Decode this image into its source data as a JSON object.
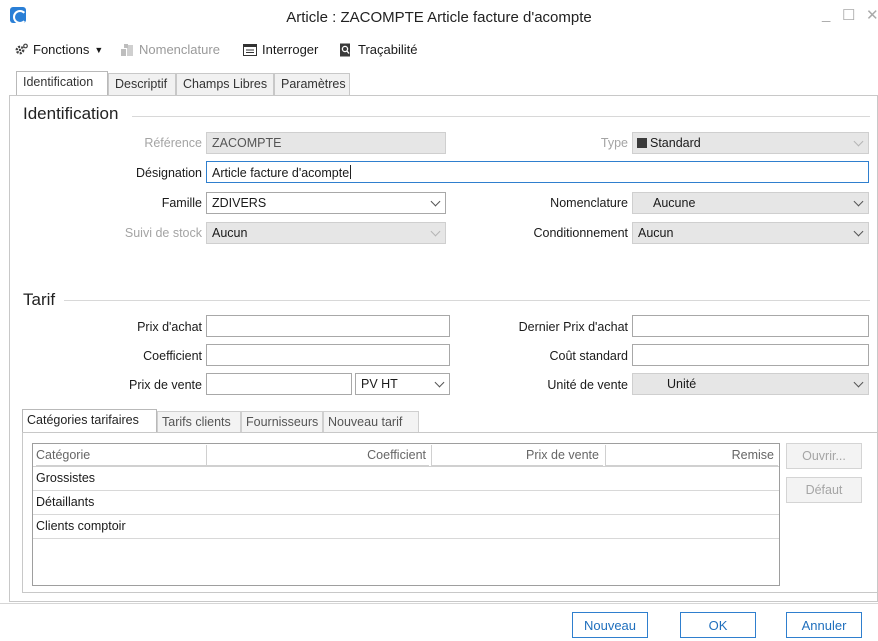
{
  "window": {
    "title": "Article : ZACOMPTE Article facture d'acompte",
    "minimize": "_",
    "maximize": "☐",
    "close": "✕"
  },
  "toolbar": {
    "fonctions": "Fonctions",
    "nomenclature": "Nomenclature",
    "interroger": "Interroger",
    "tracabilite": "Traçabilité"
  },
  "tabs": [
    "Identification",
    "Descriptif",
    "Champs Libres",
    "Paramètres"
  ],
  "identification": {
    "section_title": "Identification",
    "reference_label": "Référence",
    "reference_value": "ZACOMPTE",
    "type_label": "Type",
    "type_value": "Standard",
    "designation_label": "Désignation",
    "designation_value": "Article facture d'acompte",
    "famille_label": "Famille",
    "famille_value": "ZDIVERS",
    "nomenclature_label": "Nomenclature",
    "nomenclature_value": "Aucune",
    "suivi_label": "Suivi de stock",
    "suivi_value": "Aucun",
    "conditionnement_label": "Conditionnement",
    "conditionnement_value": "Aucun"
  },
  "tarif": {
    "section_title": "Tarif",
    "prix_achat_label": "Prix d'achat",
    "prix_achat_value": "",
    "dernier_prix_label": "Dernier Prix d'achat",
    "dernier_prix_value": "",
    "coefficient_label": "Coefficient",
    "coefficient_value": "",
    "cout_standard_label": "Coût standard",
    "cout_standard_value": "",
    "prix_vente_label": "Prix de vente",
    "prix_vente_value": "",
    "prix_vente_type": "PV HT",
    "unite_label": "Unité de vente",
    "unite_value": "Unité"
  },
  "lower_tabs": [
    "Catégories tarifaires",
    "Tarifs clients",
    "Fournisseurs",
    "Nouveau tarif"
  ],
  "grid": {
    "columns": [
      "Catégorie",
      "Coefficient",
      "Prix de vente",
      "Remise"
    ],
    "rows": [
      "Grossistes",
      "Détaillants",
      "Clients comptoir"
    ]
  },
  "side_buttons": {
    "ouvrir": "Ouvrir...",
    "defaut": "Défaut"
  },
  "footer": {
    "nouveau": "Nouveau",
    "ok": "OK",
    "annuler": "Annuler"
  },
  "colors": {
    "accent": "#2f7fce",
    "readonly_bg": "#e6e6e6",
    "disabled_text": "#a4a4a4"
  }
}
